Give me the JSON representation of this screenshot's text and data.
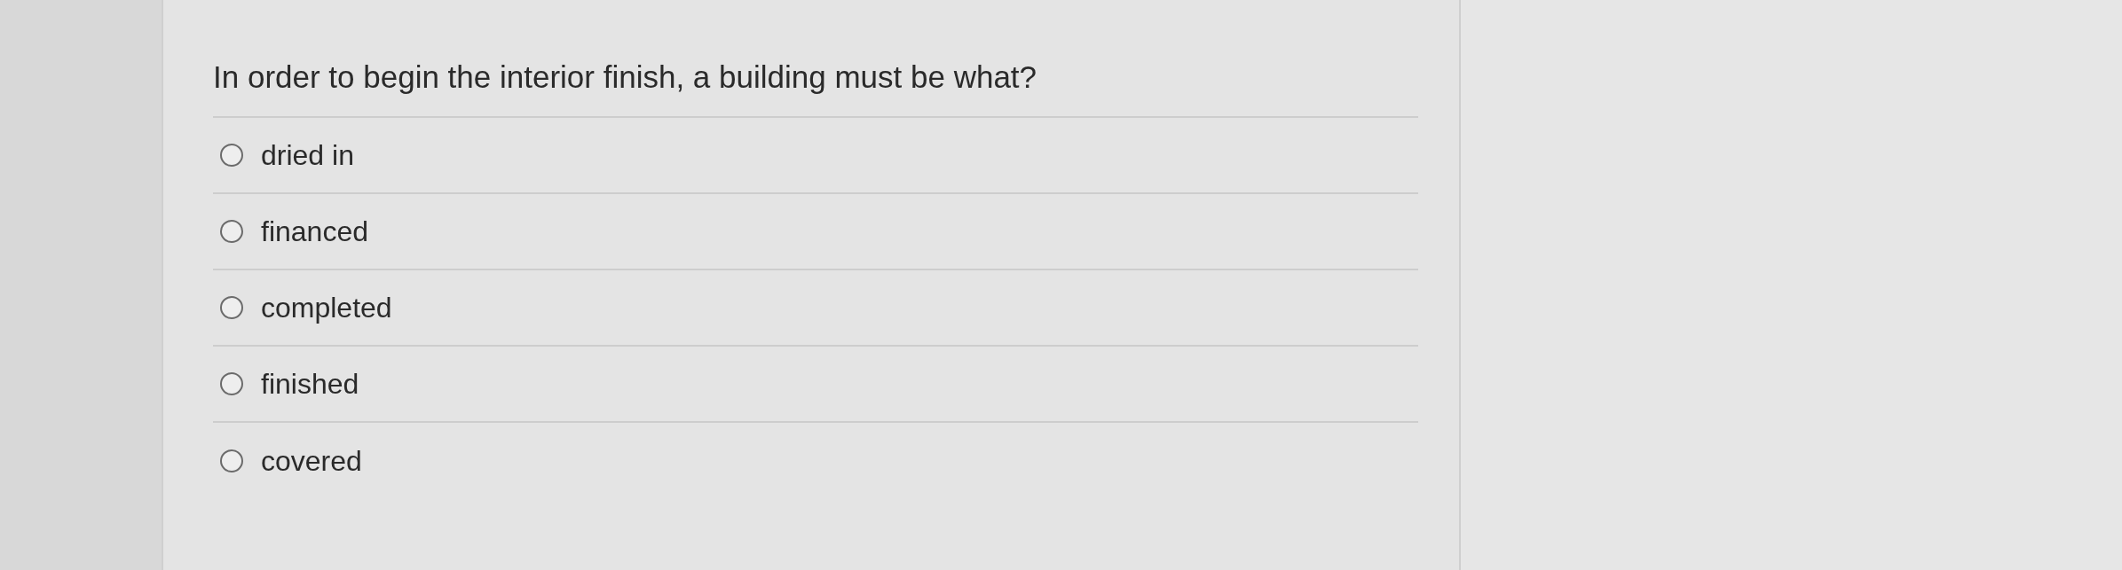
{
  "question": "In order to begin the interior finish, a building must be what?",
  "options": [
    {
      "label": "dried in",
      "selected": false
    },
    {
      "label": "financed",
      "selected": false
    },
    {
      "label": "completed",
      "selected": false
    },
    {
      "label": "finished",
      "selected": false
    },
    {
      "label": "covered",
      "selected": false
    }
  ]
}
